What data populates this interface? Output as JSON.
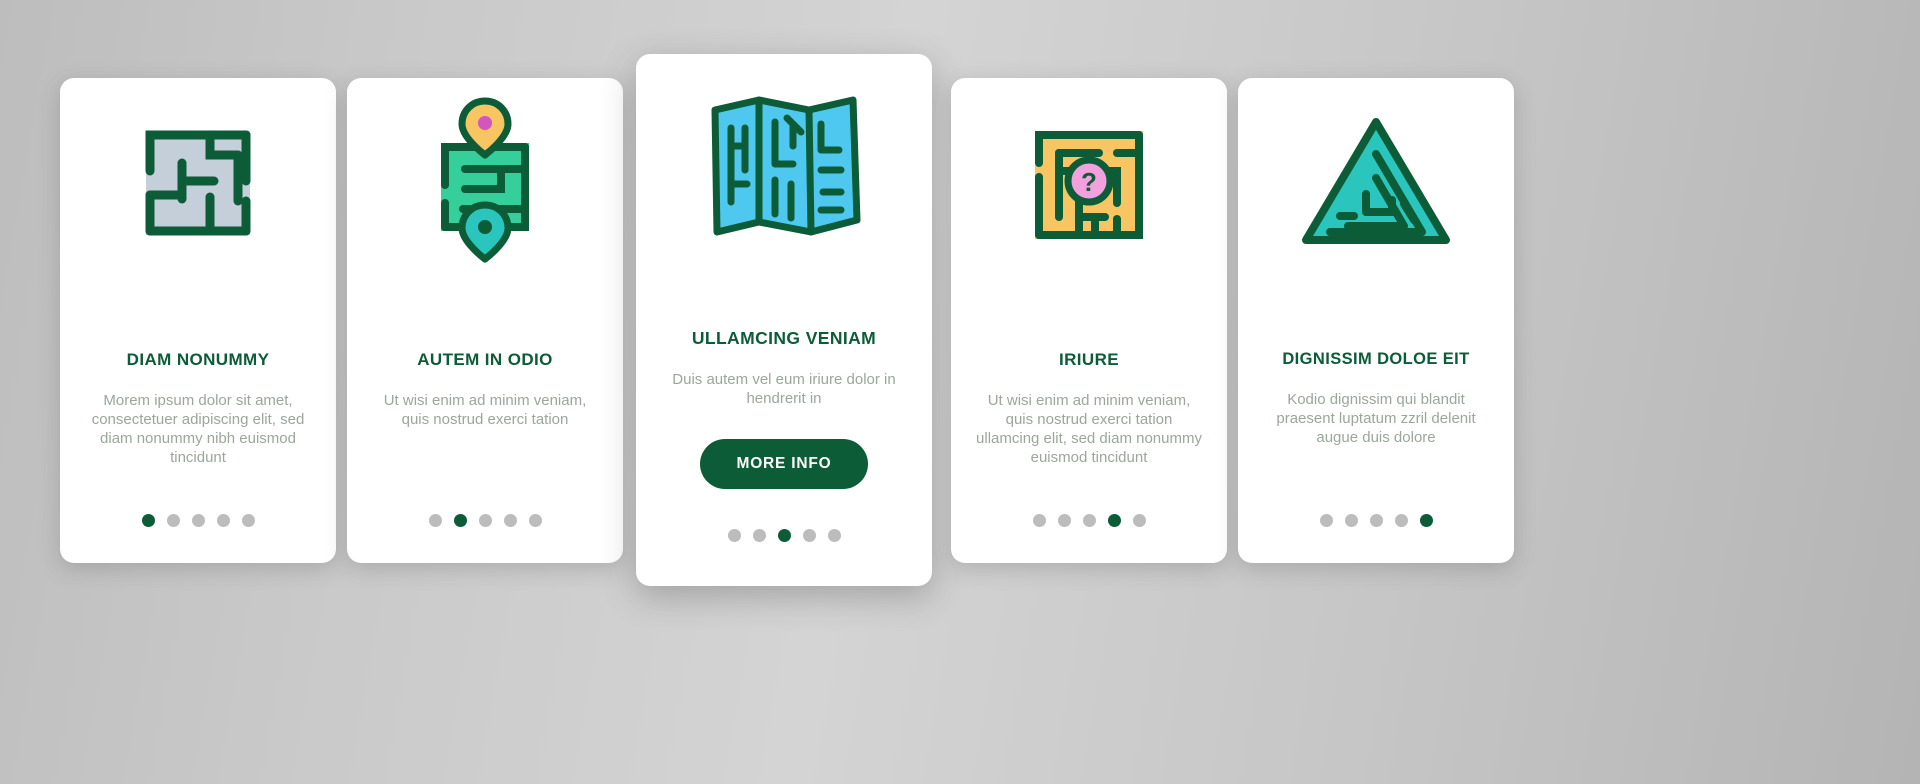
{
  "theme": {
    "brand_green": "#0c5c37",
    "body_text": "#9aa79a",
    "dot_inactive": "#bcbcbc",
    "card_bg": "#ffffff",
    "page_bg": "#c9c9c9",
    "icon_gray_fill": "#c5cfd9",
    "icon_green_fill": "#34cf9a",
    "icon_blue_fill": "#4fc8ef",
    "icon_yellow_fill": "#f7c663",
    "icon_teal_fill": "#2ac6be",
    "icon_pink_fill": "#f3a0df"
  },
  "cards": [
    {
      "id": "diam-nonummy",
      "icon": "maze-square-gray-icon",
      "title": "DIAM NONUMMY",
      "body": "Morem ipsum dolor sit amet, consectetuer adipiscing elit, sed diam nonummy nibh euismod tincidunt",
      "dots": {
        "count": 5,
        "active_index": 0
      }
    },
    {
      "id": "autem-in-odio",
      "icon": "maze-with-map-pins-icon",
      "title": "AUTEM IN ODIO",
      "body": "Ut wisi enim ad minim veniam, quis nostrud exerci tation",
      "dots": {
        "count": 5,
        "active_index": 1
      }
    },
    {
      "id": "ullamcing-veniam",
      "icon": "folded-maze-map-icon",
      "title": "ULLAMCING VENIAM",
      "body": "Duis autem vel eum iriure dolor in hendrerit in",
      "button_label": "MORE INFO",
      "dots": {
        "count": 5,
        "active_index": 2
      }
    },
    {
      "id": "iriure",
      "icon": "maze-question-mark-icon",
      "title": "IRIURE",
      "body": "Ut wisi enim ad minim veniam, quis nostrud exerci tation ullamcing elit, sed diam nonummy euismod tincidunt",
      "dots": {
        "count": 5,
        "active_index": 3
      }
    },
    {
      "id": "dignissim-doloe-eit",
      "icon": "triangle-maze-icon",
      "title": "DIGNISSIM DOLOE EIT",
      "body": "Kodio dignissim qui blandit praesent luptatum zzril delenit augue duis dolore",
      "dots": {
        "count": 5,
        "active_index": 4
      }
    }
  ]
}
